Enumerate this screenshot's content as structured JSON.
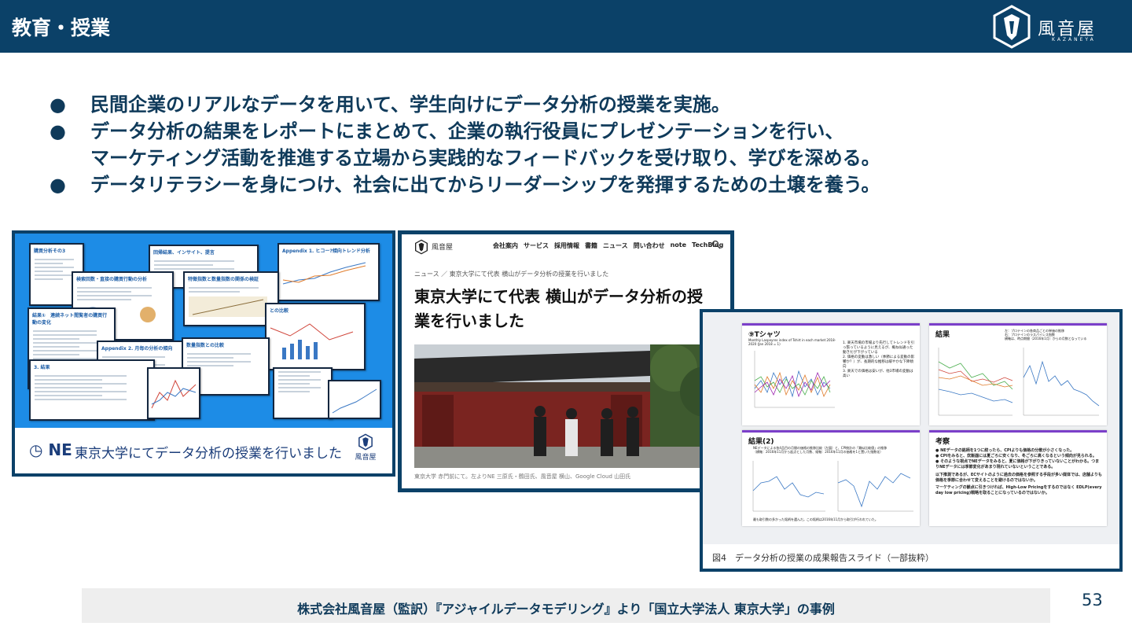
{
  "header": {
    "title": "教育・授業",
    "brand_name": "風音屋",
    "brand_roman": "KAZANEYA"
  },
  "bullets": [
    {
      "lines": [
        "民間企業のリアルなデータを用いて、学生向けにデータ分析の授業を実施。"
      ]
    },
    {
      "lines": [
        "データ分析の結果をレポートにまとめて、企業の執行役員にプレゼンテーションを行い、",
        "マーケティング活動を推進する立場から実践的なフィードバックを受け取り、学びを深める。"
      ]
    },
    {
      "lines": [
        "データリテラシーを身につけ、社会に出てからリーダーシップを発揮するための土壌を養う。"
      ]
    }
  ],
  "bullet_symbol": "●",
  "panel1": {
    "ne_logo": "NE",
    "caption": "東京大学にてデータ分析の授業を行いました",
    "logo_text": "風音屋",
    "slides": [
      {
        "title": "購買分析その3"
      },
      {
        "title": "回帰結果、インサイト、提言"
      },
      {
        "title": "Appendix 1. ヒコー?傾向トレンド分析"
      },
      {
        "title": "検索回数・直接の購買行動の分析"
      },
      {
        "title": "特徴指数と数量指数の関係の検証"
      },
      {
        "title": "結果①　連続ネット閲覧者の購買行動の変化"
      },
      {
        "title": "Appendix 2. 月毎の分析の傾向"
      },
      {
        "title": "数量指数との比較"
      },
      {
        "title": "3. 結果"
      },
      {
        "title": "との比較"
      }
    ]
  },
  "panel2": {
    "logo_text": "風音屋",
    "nav": [
      "会社案内",
      "サービス",
      "採用情報",
      "書籍",
      "ニュース",
      "問い合わせ",
      "note",
      "TechBlog"
    ],
    "breadcrumb": "ニュース ／ 東京大学にて代表 横山がデータ分析の授業を行いました",
    "title": "東京大学にて代表 横山がデータ分析の授業を行いました",
    "photo_caption": "東京大学 赤門前にて。左よりNE 三原氏・鶴田氏、風音屋 横山、Google Cloud 山田氏"
  },
  "panel3": {
    "cards": {
      "tshirt": {
        "title": "⑨Tシャツ",
        "chart_title": "Monthly Laspeyres index of Tshirt in each market 2018-2020 (Jan 2018 = 1)",
        "notes": [
          "1. 楽天市場の市場より先行してトレンドを引っ張っているように見えるが、概ね似通った動きだが下がっている",
          "2. 価格の変動は激しい（季節による変動の影響か？）が、長期的な推移は緩やかな下降傾向",
          "3. 楽天での価格は安いが、他3市場の変動は高い"
        ]
      },
      "result": {
        "title": "結果",
        "notes": [
          "左：プロテインの各商品ごとの単価の推移",
          "右：プロテインのラスパイレス指数",
          "横軸は、時点期間（2016年1月）からの月数となっている"
        ]
      },
      "result2": {
        "title": "結果(2)",
        "notes": [
          "NEデータによる各4品目の月間の価格の推移比較（左図）と、CPI統計の「類似比較値」の推移",
          "（横軸：2016年11月から起点とした月数、縦軸：2016年11月の価格を1と置いた指数化）",
          "最も取引数の多かった銘柄を選んだ。この銘柄は2016年11月から取引が行われていた。"
        ]
      },
      "consideration": {
        "title": "考察",
        "points": [
          "NEデータの銘柄を1つに絞ったら、CPIよりも価格の分散が小さくなった。",
          "CPIをみると、炊飯器には夏ごろに安くなり、冬ごろに高くなるという傾向が見られる。",
          "そのような視点でNEデータをみると、夏に価格が下がりきっていないことがわかる。つまりNEデータには季節変化があまり現れていないということである。"
        ],
        "para1": "以下推測であるが、ECサイトのように過去の価格を参照する手段が多い媒体では、店舗よりも価格を季節に合わせて変えることを避けるのではないか。",
        "para2": "マーケティングの観点に引きつければ、High-Low Pricingをするのではなく EDLP(every day low pricing)戦略を取ることになっているのではないか。"
      }
    },
    "caption": "図4　データ分析の授業の成果報告スライド（一部抜粋）"
  },
  "footer": {
    "text": "株式会社風音屋（監訳）『アジャイルデータモデリング』より「国立大学法人 東京大学」の事例",
    "page_number": "53"
  },
  "colors": {
    "header_bg": "#0b4168",
    "text": "#0f3a5a",
    "panel1_bg": "#1d8ce6",
    "card_accent": "#7b3fc9"
  }
}
